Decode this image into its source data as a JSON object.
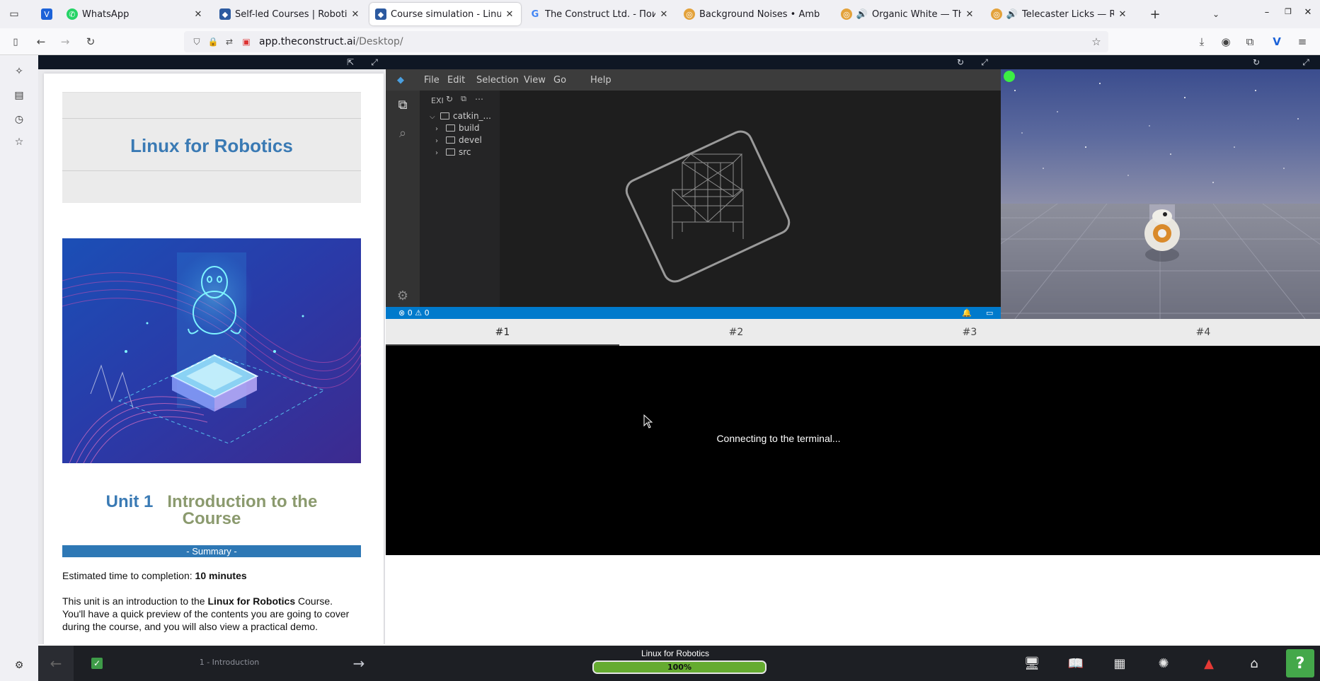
{
  "browser": {
    "tabs": [
      {
        "title": "",
        "icon": "vivid-icon"
      },
      {
        "title": "WhatsApp",
        "icon": "whatsapp-icon"
      },
      {
        "title": "Self-led Courses | Robotic",
        "icon": "construct-icon"
      },
      {
        "title": "Course simulation - Linux",
        "icon": "construct-icon"
      },
      {
        "title": "The Construct Ltd. - Поис",
        "icon": "google-icon"
      },
      {
        "title": "Background Noises • Amb",
        "icon": "noise-icon"
      },
      {
        "title": "Organic White — The",
        "icon": "speaker-icon"
      },
      {
        "title": "Telecaster Licks — Rel",
        "icon": "speaker-icon"
      }
    ],
    "new_tab": "+",
    "url_host": "app.theconstruct.ai",
    "url_path": "/Desktop/"
  },
  "notebook": {
    "title": "Linux for Robotics",
    "unit_label": "Unit 1",
    "unit_title_1": "Introduction to the",
    "unit_title_2": "Course",
    "summary": "- Summary -",
    "time_label": "Estimated time to completion: ",
    "time_value": "10 minutes",
    "intro_1": "This unit is an introduction to the ",
    "intro_bold": "Linux for Robotics",
    "intro_2": " Course.",
    "intro_line2": "You'll have a quick preview of the contents you are going to cover",
    "intro_line3": "during the course, and you will also view a practical demo."
  },
  "ide": {
    "menu": [
      "File",
      "Edit",
      "Selection",
      "View",
      "Go",
      "Help"
    ],
    "explorer_header": "EXI",
    "root_folder": "catkin_...",
    "folders": [
      "build",
      "devel",
      "src"
    ],
    "status_errors": "0",
    "status_warnings": "0"
  },
  "terminal": {
    "tabs": [
      "#1",
      "#2",
      "#3",
      "#4"
    ],
    "active_tab": 0,
    "message": "Connecting to the terminal..."
  },
  "bottom_bar": {
    "chapter": "1 - Introduction",
    "course": "Linux for Robotics",
    "progress_label": "100%",
    "progress": 1.0,
    "help": "?"
  },
  "colors": {
    "accent_blue": "#3a7ab4",
    "unit_green": "#8b9a6e",
    "vscode_status": "#007acc",
    "progress_green": "#65ab30"
  }
}
